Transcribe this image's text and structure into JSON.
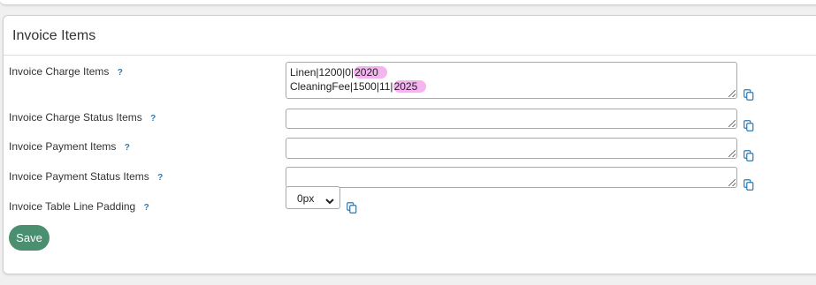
{
  "panel": {
    "title": "Invoice Items"
  },
  "help_glyph": "?",
  "fields": {
    "charge": {
      "label": "Invoice Charge Items",
      "lines": [
        {
          "plain": "Linen|1200|0|",
          "highlight": "2020"
        },
        {
          "plain": "CleaningFee|1500|11|",
          "highlight": "2025"
        }
      ]
    },
    "charge_status": {
      "label": "Invoice Charge Status Items",
      "value": ""
    },
    "payment": {
      "label": "Invoice Payment Items",
      "value": ""
    },
    "payment_status": {
      "label": "Invoice Payment Status Items",
      "value": ""
    },
    "padding": {
      "label": "Invoice Table Line Padding",
      "selected": "0px"
    }
  },
  "save_label": "Save",
  "colors": {
    "accent_green": "#4a8f6f",
    "help_blue": "#2a7ab0",
    "highlight_pink": "#f4b4f0"
  }
}
